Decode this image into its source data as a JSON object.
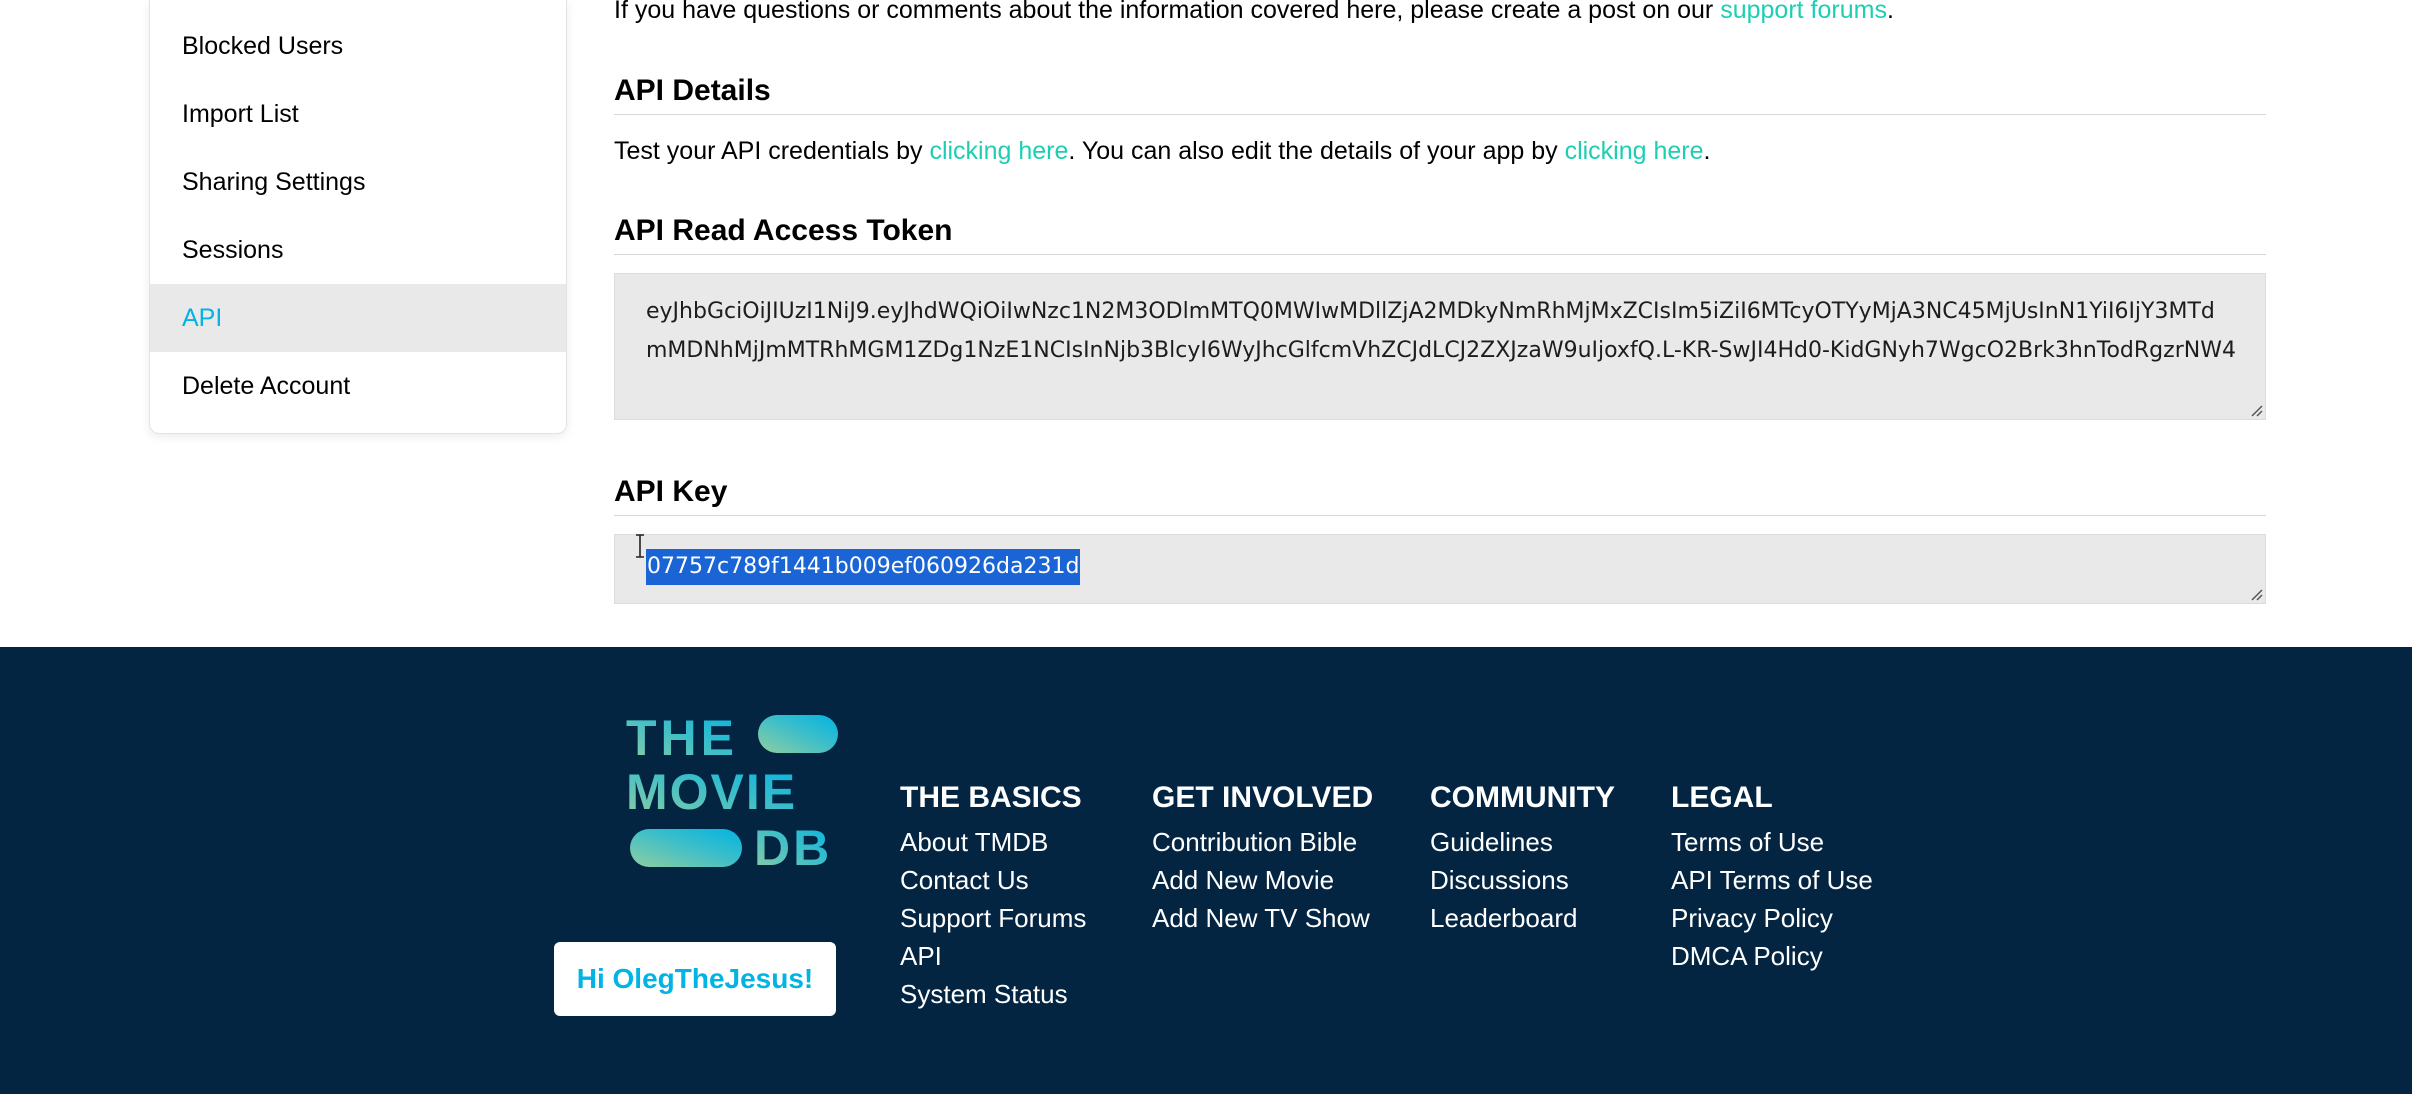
{
  "sidebar": {
    "items": [
      {
        "label": "Blocked Users"
      },
      {
        "label": "Import List"
      },
      {
        "label": "Sharing Settings"
      },
      {
        "label": "Sessions"
      },
      {
        "label": "API"
      },
      {
        "label": "Delete Account"
      }
    ],
    "active": "API"
  },
  "intro": {
    "text": "If you have questions or comments about the information covered here, please create a post on our ",
    "link": "support forums",
    "end": "."
  },
  "api_details": {
    "heading": "API Details",
    "text1": "Test your API credentials by ",
    "link1": "clicking here",
    "text2": ". You can also edit the details of your app by ",
    "link2": "clicking here",
    "end": "."
  },
  "read_token": {
    "heading": "API Read Access Token",
    "value": "eyJhbGciOiJIUzI1NiJ9.eyJhdWQiOiIwNzc1N2M3ODlmMTQ0MWIwMDllZjA2MDkyNmRhMjMxZCIsIm5iZiI6MTcyOTYyMjA3NC45MjUsInN1YiI6IjY3MTdmMDNhMjJmMTRhMGM1ZDg1NzE1NCIsInNjb3BlcyI6WyJhcGlfcmVhZCJdLCJ2ZXJzaW9uIjoxfQ.L-KR-SwJI4Hd0-KidGNyh7WgcO2Brk3hnTodRgzrNW4"
  },
  "api_key": {
    "heading": "API Key",
    "value": "07757c789f1441b009ef060926da231d"
  },
  "footer": {
    "greeting": "Hi OlegTheJesus!",
    "logo_text": [
      "THE",
      "MOVIE",
      "DB"
    ],
    "columns": [
      {
        "title": "THE BASICS",
        "links": [
          "About TMDB",
          "Contact Us",
          "Support Forums",
          "API",
          "System Status"
        ]
      },
      {
        "title": "GET INVOLVED",
        "links": [
          "Contribution Bible",
          "Add New Movie",
          "Add New TV Show"
        ]
      },
      {
        "title": "COMMUNITY",
        "links": [
          "Guidelines",
          "Discussions",
          "Leaderboard"
        ]
      },
      {
        "title": "LEGAL",
        "links": [
          "Terms of Use",
          "API Terms of Use",
          "Privacy Policy",
          "DMCA Policy"
        ]
      }
    ]
  },
  "colors": {
    "accent_blue": "#01b4e4",
    "accent_green": "#1ccfb3",
    "footer_bg": "#032541",
    "selection": "#1a64d6"
  }
}
